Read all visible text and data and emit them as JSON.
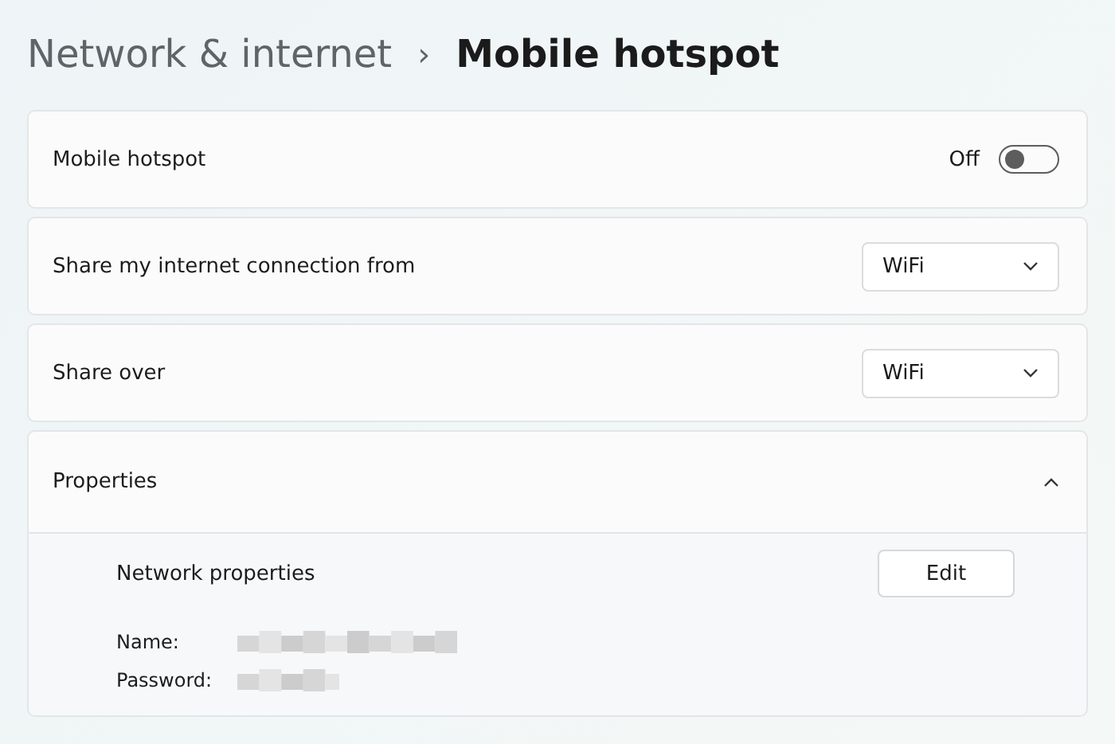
{
  "breadcrumb": {
    "parent": "Network & internet",
    "separator": "›",
    "current": "Mobile hotspot"
  },
  "hotspot": {
    "label": "Mobile hotspot",
    "state_text": "Off",
    "on": false
  },
  "dropdowns": [
    {
      "label": "Share my internet connection from",
      "value": "WiFi"
    },
    {
      "label": "Share over",
      "value": "WiFi"
    }
  ],
  "properties": {
    "label": "Properties",
    "expanded": true,
    "network_label": "Network properties",
    "edit_button": "Edit",
    "fields": [
      {
        "label": "Name:"
      },
      {
        "label": "Password:"
      }
    ]
  }
}
